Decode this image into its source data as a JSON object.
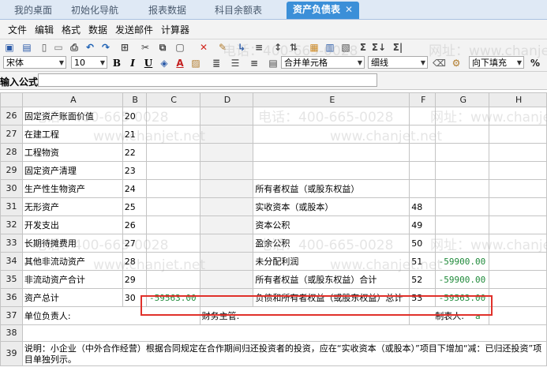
{
  "tabs": [
    {
      "label": "我的桌面"
    },
    {
      "label": "初始化导航"
    },
    {
      "label": "报表数据"
    },
    {
      "label": "科目余额表"
    },
    {
      "label": "资产负债表",
      "active": true,
      "close": "✕"
    }
  ],
  "menu": [
    "文件",
    "编辑",
    "格式",
    "数据",
    "发送邮件",
    "计算器"
  ],
  "font": {
    "family": "宋体",
    "size": "10"
  },
  "toolbar": {
    "merge_select": "合并单元格",
    "border_select": "细线",
    "fill_select": "向下填充",
    "percent": "%",
    "sigma1": "Σ",
    "sigma2": "Σ↓",
    "sigma3": "Σ|"
  },
  "formula": {
    "label": "输入公式：",
    "value": ""
  },
  "columns": [
    "A",
    "B",
    "C",
    "D",
    "E",
    "F",
    "G",
    "H"
  ],
  "rows": [
    {
      "n": "26",
      "a": "固定资产账面价值",
      "b": "20",
      "c": "",
      "e": "",
      "f": "",
      "g": ""
    },
    {
      "n": "27",
      "a": "在建工程",
      "b": "21",
      "c": "",
      "e": "",
      "f": "",
      "g": ""
    },
    {
      "n": "28",
      "a": "工程物资",
      "b": "22",
      "c": "",
      "e": "",
      "f": "",
      "g": ""
    },
    {
      "n": "29",
      "a": "固定资产清理",
      "b": "23",
      "c": "",
      "e": "",
      "f": "",
      "g": ""
    },
    {
      "n": "30",
      "a": "生产性生物资产",
      "b": "24",
      "c": "",
      "e": "所有者权益（或股东权益）",
      "f": "",
      "g": ""
    },
    {
      "n": "31",
      "a": "无形资产",
      "b": "25",
      "c": "",
      "e": "实收资本（或股本）",
      "f": "48",
      "g": ""
    },
    {
      "n": "32",
      "a": "开发支出",
      "b": "26",
      "c": "",
      "e": "资本公积",
      "f": "49",
      "g": ""
    },
    {
      "n": "33",
      "a": "长期待摊费用",
      "b": "27",
      "c": "",
      "e": "盈余公积",
      "f": "50",
      "g": ""
    },
    {
      "n": "34",
      "a": "其他非流动资产",
      "b": "28",
      "c": "",
      "e": "未分配利润",
      "f": "51",
      "g": "-59900.00"
    },
    {
      "n": "35",
      "a": "非流动资产合计",
      "b": "29",
      "c": "",
      "e": "所有者权益（或股东权益）合计",
      "f": "52",
      "g": "-59900.00"
    },
    {
      "n": "36",
      "a": "资产总计",
      "b": "30",
      "c": "-59563.00",
      "e": "负债和所有者权益（或股东权益）总计",
      "f": "53",
      "g": "-59563.00"
    }
  ],
  "footer": {
    "row37": {
      "n": "37",
      "a": "单位负责人:",
      "d": "财务主管:",
      "f": "制表人:",
      "g": "a"
    },
    "row38": {
      "n": "38"
    },
    "row39": {
      "n": "39",
      "note": "说明：小企业（中外合作经营）根据合同规定在合作期间归还投资者的投资，应在“实收资本（或股本）”项目下增加“减：已归还投资”项目单独列示。"
    }
  },
  "watermark": {
    "phone": "电话：400-665-0028",
    "site_label": "网址：www.chanjet.net",
    "site": "www.chanjet.net"
  },
  "colors": {
    "active_tab": "#3b8fd8",
    "positive_num": "#1f8a3a",
    "highlight": "#e0312b"
  }
}
